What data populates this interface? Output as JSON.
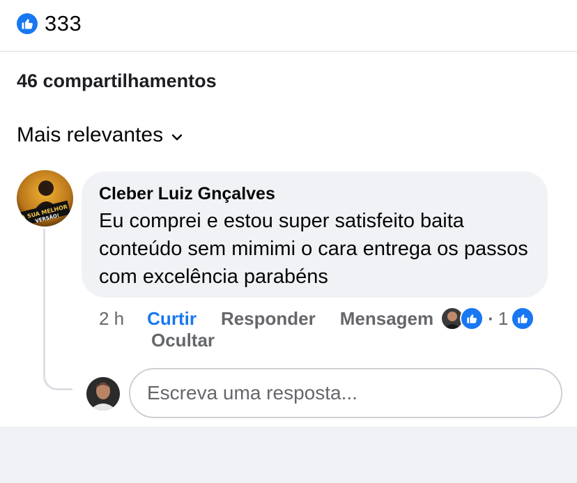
{
  "reactions": {
    "icon": "thumbs-up-icon",
    "count": "333",
    "color": "#1877f2"
  },
  "shares": {
    "text": "46 compartilhamentos"
  },
  "sort": {
    "label": "Mais relevantes",
    "icon": "chevron-down-icon"
  },
  "comment": {
    "avatar_badge_text": "A SUA MELHOR VERSÃO!",
    "author": "Cleber Luiz Gnçalves",
    "text": "Eu comprei e estou super satisfeito baita conteúdo sem mimimi o cara entrega os passos com excelência parabéns",
    "time": "2 h",
    "like_label": "Curtir",
    "reply_label": "Responder",
    "message_label": "Mensagem",
    "reaction_separator": "·",
    "reaction_count": "1",
    "hide_label": "Ocultar"
  },
  "reply_box": {
    "placeholder": "Escreva uma resposta..."
  },
  "colors": {
    "accent": "#1877f2",
    "bubble": "#f0f2f5",
    "secondary_text": "#65676b"
  }
}
